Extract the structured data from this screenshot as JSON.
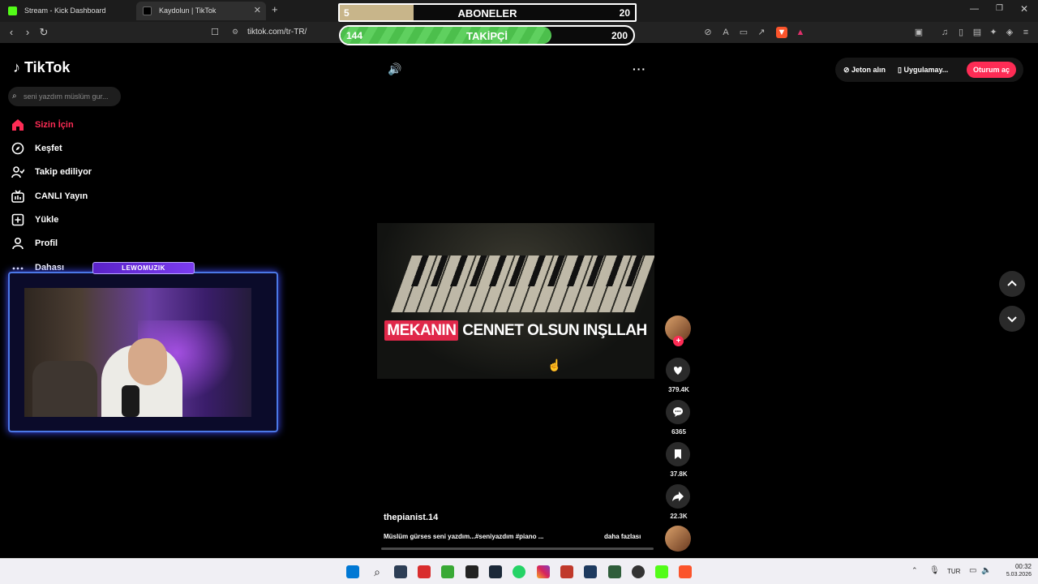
{
  "browser": {
    "tabs": [
      {
        "title": "Stream - Kick Dashboard",
        "icon": "kick-icon",
        "color": "#53fc18"
      },
      {
        "title": "Kaydolun | TikTok",
        "icon": "tiktok-icon",
        "color": "#ffffff"
      }
    ],
    "new_tab": "+",
    "url": "tiktok.com/tr-TR/"
  },
  "overlay": {
    "subscribers": {
      "label": "ABONELER",
      "current": "5",
      "goal": "20",
      "progress": 0.25
    },
    "followers": {
      "label": "TAKİPÇİ",
      "current": "144",
      "goal": "200",
      "progress": 0.72
    }
  },
  "tiktok": {
    "logo": "TikTok",
    "search_placeholder": "seni yazdım müslüm gur...",
    "nav": [
      {
        "label": "Sizin İçin",
        "icon": "home-icon",
        "active": true
      },
      {
        "label": "Keşfet",
        "icon": "compass-icon"
      },
      {
        "label": "Takip ediliyor",
        "icon": "following-icon"
      },
      {
        "label": "CANLI Yayın",
        "icon": "live-icon"
      },
      {
        "label": "Yükle",
        "icon": "upload-icon"
      },
      {
        "label": "Profil",
        "icon": "profile-icon"
      },
      {
        "label": "Dahası",
        "icon": "more-icon"
      }
    ],
    "header": {
      "coins": "Jeton alın",
      "app": "Uygulamay...",
      "login": "Oturum aç"
    },
    "video": {
      "caption_highlight": "MEKANIN",
      "caption_rest": " CENNET OLSUN INŞLLAH",
      "author": "thepianist.14",
      "description": "Müslüm gürses seni yazdım...#seniyazdım #piano ...",
      "more": "daha fazlası",
      "likes": "379.4K",
      "comments": "6365",
      "saves": "37.8K",
      "shares": "22.3K"
    }
  },
  "webcam": {
    "badge": "LEWOMUZIK"
  },
  "taskbar": {
    "language": "TUR",
    "time": "00:32",
    "date": "5.03.2026"
  },
  "colors": {
    "accent": "#fe2c55",
    "progress_green": "#4cbf4c",
    "progress_gold": "#c8b58a"
  }
}
